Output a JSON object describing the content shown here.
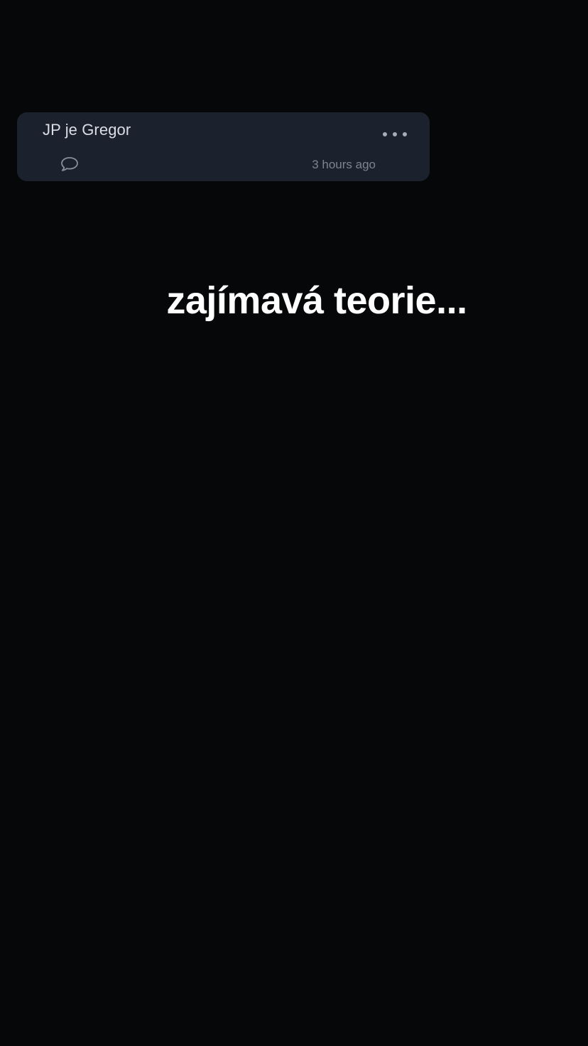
{
  "post": {
    "text": "JP je Gregor",
    "timestamp": "3 hours ago",
    "more_icon": "ellipsis-icon",
    "comment_icon": "speech-bubble-icon"
  },
  "caption": {
    "text": "zajímavá teorie..."
  },
  "colors": {
    "background": "#060708",
    "card": "#1c222d",
    "card_text": "#d9dde4",
    "muted": "#7c8490",
    "caption": "#ffffff"
  }
}
